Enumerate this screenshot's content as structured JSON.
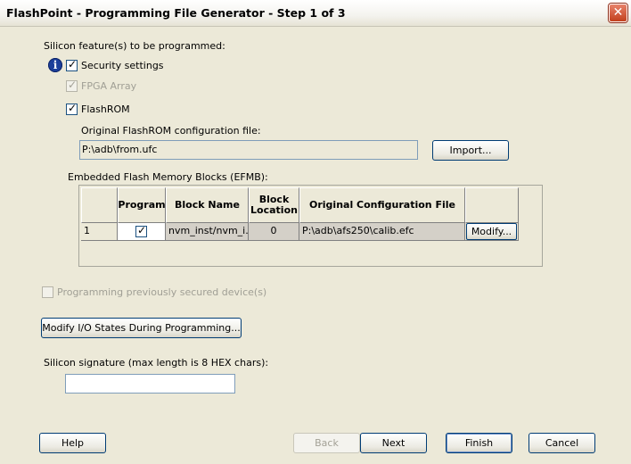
{
  "window": {
    "title": "FlashPoint - Programming File Generator   - Step 1 of 3",
    "close_glyph": "✕"
  },
  "features": {
    "heading": "Silicon feature(s) to be programmed:",
    "security": {
      "label": "Security settings",
      "checked": true
    },
    "fpga": {
      "label": "FPGA Array",
      "checked": true,
      "enabled": false
    },
    "flashrom": {
      "label": "FlashROM",
      "checked": true
    }
  },
  "flashrom_config": {
    "label": "Original FlashROM configuration file:",
    "value": "P:\\adb\\from.ufc",
    "import_button": "Import..."
  },
  "efmb": {
    "label": "Embedded Flash Memory Blocks (EFMB):",
    "columns": [
      "",
      "Program",
      "Block Name",
      "Block Location",
      "Original Configuration File",
      ""
    ],
    "rows": [
      {
        "index": "1",
        "program": true,
        "block_name": "nvm_inst/nvm_i...",
        "block_location": "0",
        "config_file": "P:\\adb\\afs250\\calib.efc",
        "action": "Modify..."
      }
    ]
  },
  "prev_secured": {
    "label": "Programming previously secured device(s)",
    "checked": false,
    "enabled": false
  },
  "modify_io_button": "Modify I/O States During Programming...",
  "signature": {
    "label": "Silicon signature (max length is 8 HEX chars):",
    "value": ""
  },
  "footer": {
    "help": "Help",
    "back": "Back",
    "next": "Next",
    "finish": "Finish",
    "cancel": "Cancel"
  },
  "icons": {
    "info": "info-icon",
    "check": "checkmark-icon",
    "close": "close-icon"
  },
  "colors": {
    "background": "#ece9d8",
    "close_button": "#c2401d",
    "info_icon": "#1d3f9a"
  }
}
